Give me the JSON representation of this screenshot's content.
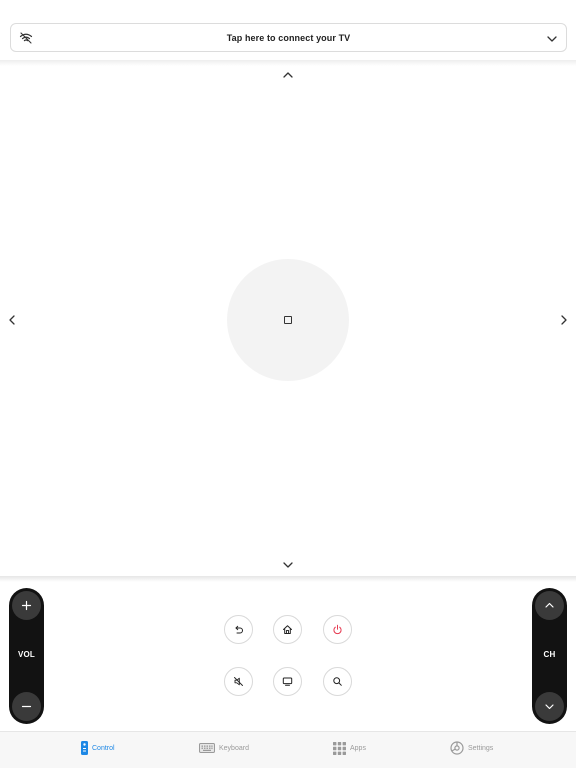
{
  "connect": {
    "label": "Tap here to connect your TV",
    "icon_left": "wifi-icon",
    "icon_right": "chevron-down-icon"
  },
  "dpad": {
    "up_icon": "chevron-up-icon",
    "down_icon": "chevron-down-icon",
    "left_icon": "chevron-left-icon",
    "right_icon": "chevron-right-icon",
    "ok_icon": "square-icon"
  },
  "volume": {
    "label": "VOL",
    "up_icon": "plus-icon",
    "down_icon": "minus-icon"
  },
  "channel": {
    "label": "CH",
    "up_icon": "chevron-up-icon",
    "down_icon": "chevron-down-icon"
  },
  "controls": [
    {
      "name": "back",
      "icon": "back-arrow-icon"
    },
    {
      "name": "home",
      "icon": "home-icon"
    },
    {
      "name": "power",
      "icon": "power-icon"
    },
    {
      "name": "mute",
      "icon": "mute-icon"
    },
    {
      "name": "input",
      "icon": "tv-input-icon"
    },
    {
      "name": "search",
      "icon": "search-icon"
    }
  ],
  "colors": {
    "accent": "#1e88e5",
    "power": "#e53950",
    "rocker": "#121212",
    "ok_button": "#f3f3f3"
  },
  "tabs": [
    {
      "label": "Control",
      "icon": "remote-icon",
      "active": true
    },
    {
      "label": "Keyboard",
      "icon": "keyboard-icon",
      "active": false
    },
    {
      "label": "Apps",
      "icon": "apps-grid-icon",
      "active": false
    },
    {
      "label": "Settings",
      "icon": "settings-icon",
      "active": false
    }
  ]
}
